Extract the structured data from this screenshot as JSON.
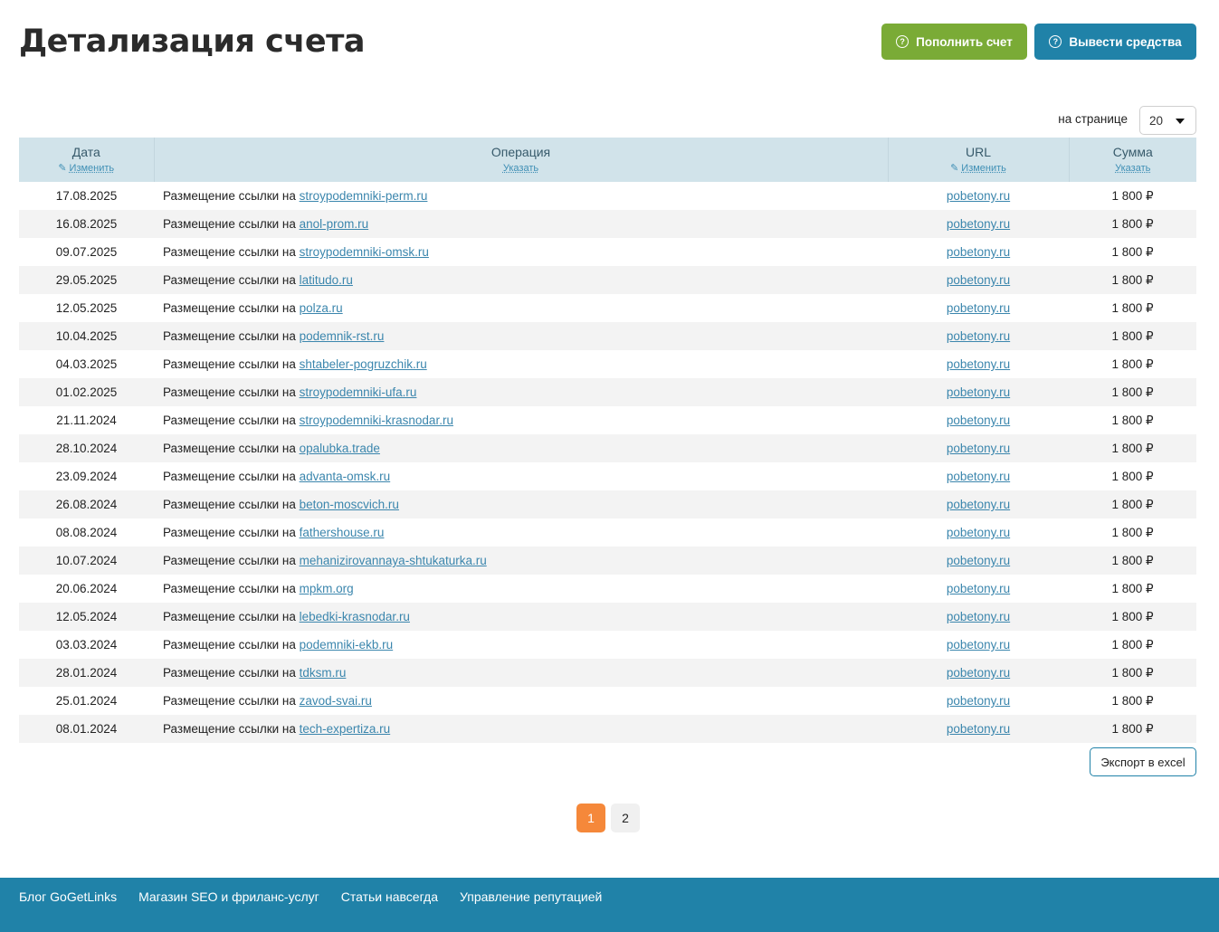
{
  "page": {
    "title": "Детализация счета",
    "topup_label": "Пополнить счет",
    "withdraw_label": "Вывести средства",
    "per_page_label": "на странице",
    "per_page_value": "20",
    "export_label": "Экспорт в excel"
  },
  "table": {
    "columns": [
      {
        "title": "Дата",
        "action": "Изменить"
      },
      {
        "title": "Операция",
        "action": "Указать"
      },
      {
        "title": "URL",
        "action": "Изменить"
      },
      {
        "title": "Сумма",
        "action": "Указать"
      }
    ],
    "op_prefix": "Размещение ссылки на",
    "rows": [
      {
        "date": "17.08.2025",
        "site": "stroypodemniki-perm.ru",
        "url": "pobetony.ru",
        "sum": "1 800 ₽"
      },
      {
        "date": "16.08.2025",
        "site": "anol-prom.ru",
        "url": "pobetony.ru",
        "sum": "1 800 ₽"
      },
      {
        "date": "09.07.2025",
        "site": "stroypodemniki-omsk.ru",
        "url": "pobetony.ru",
        "sum": "1 800 ₽"
      },
      {
        "date": "29.05.2025",
        "site": "latitudo.ru",
        "url": "pobetony.ru",
        "sum": "1 800 ₽"
      },
      {
        "date": "12.05.2025",
        "site": "polza.ru",
        "url": "pobetony.ru",
        "sum": "1 800 ₽"
      },
      {
        "date": "10.04.2025",
        "site": "podemnik-rst.ru",
        "url": "pobetony.ru",
        "sum": "1 800 ₽"
      },
      {
        "date": "04.03.2025",
        "site": "shtabeler-pogruzchik.ru",
        "url": "pobetony.ru",
        "sum": "1 800 ₽"
      },
      {
        "date": "01.02.2025",
        "site": "stroypodemniki-ufa.ru",
        "url": "pobetony.ru",
        "sum": "1 800 ₽"
      },
      {
        "date": "21.11.2024",
        "site": "stroypodemniki-krasnodar.ru",
        "url": "pobetony.ru",
        "sum": "1 800 ₽"
      },
      {
        "date": "28.10.2024",
        "site": "opalubka.trade",
        "url": "pobetony.ru",
        "sum": "1 800 ₽"
      },
      {
        "date": "23.09.2024",
        "site": "advanta-omsk.ru",
        "url": "pobetony.ru",
        "sum": "1 800 ₽"
      },
      {
        "date": "26.08.2024",
        "site": "beton-moscvich.ru",
        "url": "pobetony.ru",
        "sum": "1 800 ₽"
      },
      {
        "date": "08.08.2024",
        "site": "fathershouse.ru",
        "url": "pobetony.ru",
        "sum": "1 800 ₽"
      },
      {
        "date": "10.07.2024",
        "site": "mehanizirovannaya-shtukaturka.ru",
        "url": "pobetony.ru",
        "sum": "1 800 ₽"
      },
      {
        "date": "20.06.2024",
        "site": "mpkm.org",
        "url": "pobetony.ru",
        "sum": "1 800 ₽"
      },
      {
        "date": "12.05.2024",
        "site": "lebedki-krasnodar.ru",
        "url": "pobetony.ru",
        "sum": "1 800 ₽"
      },
      {
        "date": "03.03.2024",
        "site": "podemniki-ekb.ru",
        "url": "pobetony.ru",
        "sum": "1 800 ₽"
      },
      {
        "date": "28.01.2024",
        "site": "tdksm.ru",
        "url": "pobetony.ru",
        "sum": "1 800 ₽"
      },
      {
        "date": "25.01.2024",
        "site": "zavod-svai.ru",
        "url": "pobetony.ru",
        "sum": "1 800 ₽"
      },
      {
        "date": "08.01.2024",
        "site": "tech-expertiza.ru",
        "url": "pobetony.ru",
        "sum": "1 800 ₽"
      }
    ]
  },
  "pagination": {
    "pages": [
      "1",
      "2"
    ],
    "current": "1"
  },
  "footer": {
    "links": [
      "Блог GoGetLinks",
      "Магазин SEO и фриланс-услуг",
      "Статьи навсегда",
      "Управление репутацией"
    ]
  },
  "icons": {
    "topup": "question-circle-icon",
    "withdraw": "question-circle-icon",
    "edit": "pencil-icon",
    "dropdown": "caret-down-icon"
  },
  "colors": {
    "green_button": "#7aab36",
    "blue_button": "#2082a8",
    "table_header": "#d1e3ea",
    "link": "#3b86ad",
    "active_page": "#f5883a",
    "footer": "#2082a8"
  }
}
